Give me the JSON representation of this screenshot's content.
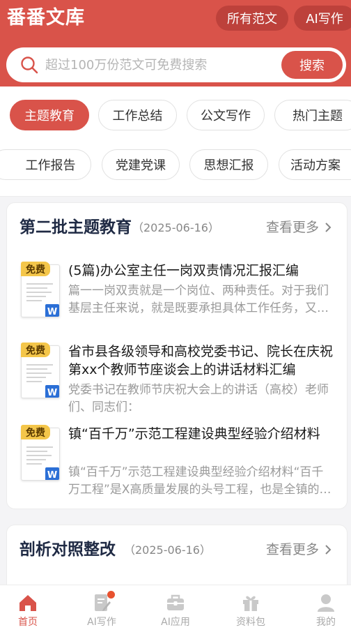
{
  "header": {
    "brand": "番番文库",
    "nav_pills": [
      "所有范文",
      "AI写作"
    ]
  },
  "search": {
    "placeholder": "超过100万份范文可免费搜索",
    "button": "搜索"
  },
  "categories": {
    "row1": [
      "主题教育",
      "工作总结",
      "公文写作",
      "热门主题"
    ],
    "row2": [
      "工作报告",
      "党建党课",
      "思想汇报",
      "活动方案"
    ],
    "active": "主题教育"
  },
  "sections": [
    {
      "title": "第二批主题教育",
      "date": "（2025-06-16）",
      "more": "查看更多",
      "items": [
        {
          "tag": "免费",
          "file_type": "W",
          "title": "(5篇)办公室主任一岗双责情况汇报汇编",
          "desc": "篇一一岗双责就是一个岗位、两种责任。对于我们基层主任来说，就是既要承担具体工作任务，又要承担党风廉政建设责任。"
        },
        {
          "tag": "免费",
          "file_type": "W",
          "title": "省市县各级领导和高校党委书记、院长在庆祝第xx个教师节座谈会上的讲话材料汇编",
          "desc": "党委书记在教师节庆祝大会上的讲话（高校）老师们、同志们："
        },
        {
          "tag": "免费",
          "file_type": "W",
          "title": "镇“百千万”示范工程建设典型经验介绍材料",
          "desc": "镇“百千万”示范工程建设典型经验介绍材料“百千万工程”是X高质量发展的头号工程，也是全镇的重点工作。"
        }
      ]
    },
    {
      "title": "剖析对照整改",
      "date": "（2025-06-16）",
      "more": "查看更多"
    }
  ],
  "bottom_nav": [
    {
      "label": "首页",
      "icon": "home-icon",
      "active": true
    },
    {
      "label": "AI写作",
      "icon": "ai-write-icon",
      "active": false,
      "badge": true
    },
    {
      "label": "AI应用",
      "icon": "toolbox-icon",
      "active": false
    },
    {
      "label": "资料包",
      "icon": "gift-icon",
      "active": false
    },
    {
      "label": "我的",
      "icon": "user-icon",
      "active": false
    }
  ],
  "colors": {
    "primary": "#d9534a",
    "tag_yellow": "#f4c64a",
    "word_blue": "#2b6fd6",
    "badge_orange": "#e8522f"
  }
}
